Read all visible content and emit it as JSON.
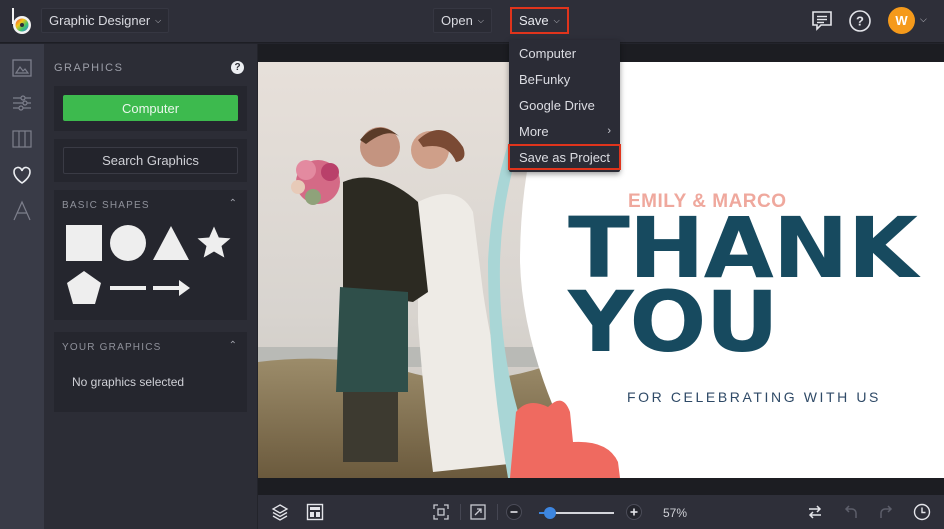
{
  "topbar": {
    "app_name": "Graphic Designer",
    "open_label": "Open",
    "save_label": "Save",
    "user_initial": "W",
    "accent_color": "#f59a1b"
  },
  "save_menu": {
    "items": [
      {
        "label": "Computer"
      },
      {
        "label": "BeFunky"
      },
      {
        "label": "Google Drive"
      },
      {
        "label": "More",
        "has_submenu": true,
        "chevron": "›"
      },
      {
        "label": "Save as Project",
        "highlighted": true
      }
    ]
  },
  "rail": {
    "items": [
      "image-icon",
      "sliders-icon",
      "frames-icon",
      "heart-icon",
      "text-icon"
    ],
    "active": "heart-icon"
  },
  "panel": {
    "title": "GRAPHICS",
    "help": "?",
    "computer_button": "Computer",
    "search_button": "Search Graphics",
    "basic_shapes": {
      "title": "BASIC SHAPES",
      "shapes": [
        "square",
        "circle",
        "triangle",
        "star",
        "pentagon",
        "line",
        "arrow"
      ]
    },
    "your_graphics": {
      "title": "YOUR GRAPHICS",
      "empty_message": "No graphics selected"
    }
  },
  "canvas": {
    "names": "EMILY & MARCO",
    "line1": "THANK",
    "line2": "YOU",
    "subtitle": "FOR CELEBRATING WITH US",
    "colors": {
      "title": "#174a5f",
      "names": "#efa89d",
      "accent_teal": "#a9d6d6",
      "accent_coral": "#ef6a60"
    }
  },
  "bottombar": {
    "zoom_percent": 57,
    "zoom_label": "57%",
    "zoom_slider_fraction": 0.15
  }
}
